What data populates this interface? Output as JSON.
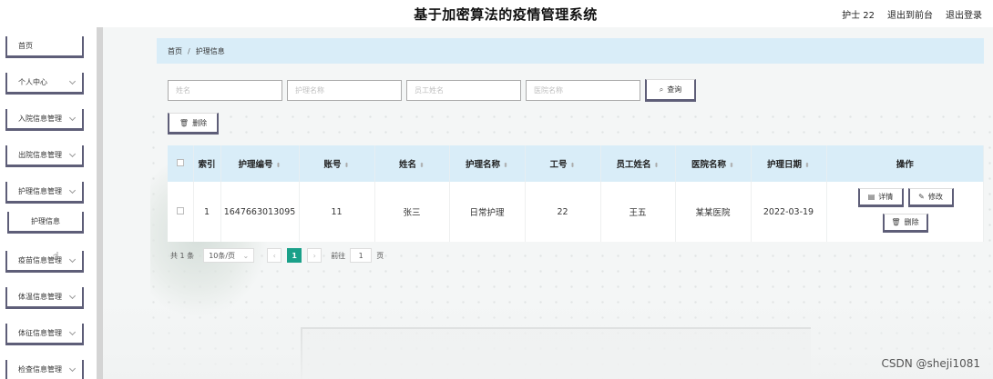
{
  "header": {
    "title": "基于加密算法的疫情管理系统",
    "user": "护士 22",
    "to_front": "退出到前台",
    "logout": "退出登录"
  },
  "sidebar": {
    "items": [
      {
        "label": "首页"
      },
      {
        "label": "个人中心"
      },
      {
        "label": "入院信息管理"
      },
      {
        "label": "出院信息管理"
      },
      {
        "label": "护理信息管理"
      },
      {
        "label": "疫苗信息管理"
      },
      {
        "label": "体温信息管理"
      },
      {
        "label": "体征信息管理"
      },
      {
        "label": "检查信息管理"
      }
    ],
    "sub_item": "护理信息"
  },
  "breadcrumb": {
    "home": "首页",
    "separator": "/",
    "current": "护理信息"
  },
  "search": {
    "name_placeholder": "姓名",
    "care_name_placeholder": "护理名称",
    "staff_name_placeholder": "员工姓名",
    "hospital_placeholder": "医院名称",
    "query_label": "查询"
  },
  "actions": {
    "delete_label": "删除"
  },
  "table": {
    "headers": [
      "索引",
      "护理编号",
      "账号",
      "姓名",
      "护理名称",
      "工号",
      "员工姓名",
      "医院名称",
      "护理日期",
      "操作"
    ],
    "rows": [
      {
        "index": "1",
        "care_no": "1647663013095",
        "account": "11",
        "name": "张三",
        "care_name": "日常护理",
        "staff_no": "22",
        "staff_name": "王五",
        "hospital": "某某医院",
        "date": "2022-03-19",
        "detail_label": "详情",
        "edit_label": "修改",
        "delete_label": "删除"
      }
    ]
  },
  "pagination": {
    "total": "共 1 条",
    "page_size": "10条/页",
    "current_page": "1",
    "goto_label": "前往",
    "goto_value": "1",
    "page_suffix": "页"
  },
  "watermark": "CSDN @sheji1081",
  "colors": {
    "accent": "#1aa089",
    "header_bg": "#d9edf8",
    "button_border": "#5e5e78"
  }
}
